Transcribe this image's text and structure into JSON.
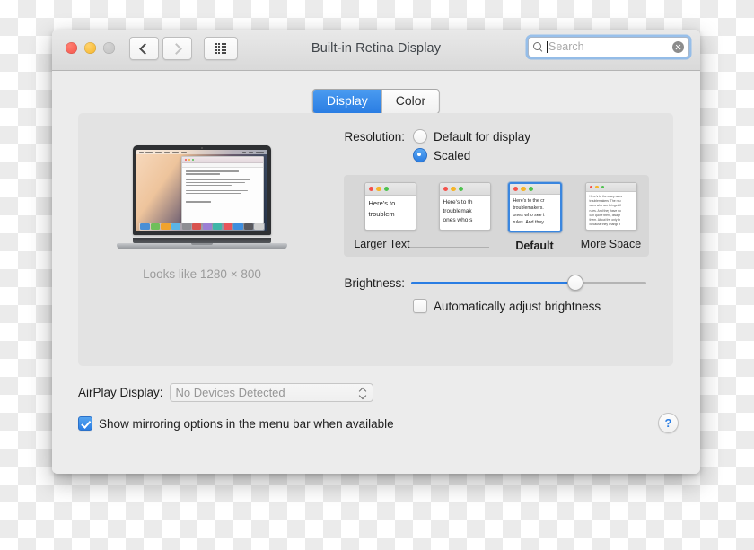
{
  "window": {
    "title": "Built-in Retina Display",
    "traffic_lights": [
      "close",
      "minimize",
      "zoom"
    ],
    "nav": {
      "back_icon": "chevron-left-icon",
      "forward_icon": "chevron-right-icon",
      "grid_icon": "show-all-grid-icon"
    },
    "search": {
      "placeholder": "Search",
      "value": "",
      "clear_icon": "clear-icon",
      "icon": "search-icon"
    }
  },
  "tabs": [
    {
      "label": "Display",
      "selected": true
    },
    {
      "label": "Color",
      "selected": false
    }
  ],
  "preview": {
    "caption": "Looks like 1280 × 800",
    "device": "macbook-retina",
    "doc_lines": [
      72,
      46,
      0,
      88,
      80,
      62,
      0,
      84,
      76,
      70,
      0,
      34,
      0,
      90
    ]
  },
  "resolution": {
    "label": "Resolution:",
    "options": [
      {
        "label": "Default for display",
        "selected": false
      },
      {
        "label": "Scaled",
        "selected": true
      }
    ]
  },
  "scaled": {
    "selected_index": 2,
    "thumbnails": [
      {
        "label": "Larger Text",
        "size": "sz-lg",
        "selected": false,
        "lines": [
          "Here's to",
          "troublem"
        ]
      },
      {
        "label": "",
        "size": "sz-md",
        "selected": false,
        "lines": [
          "Here's to th",
          "troublemak",
          "ones who s"
        ]
      },
      {
        "label": "Default",
        "size": "sz-sm",
        "selected": true,
        "lines": [
          "Here's to the cr",
          "troublemakers.",
          "ones who see t",
          "rules. And they"
        ]
      },
      {
        "label": "More Space",
        "size": "sz-xs",
        "selected": false,
        "lines": [
          "Here's to the crazy ones",
          "troublemakers. The rou",
          "ones who see things dif",
          "rules. And they have no",
          "can quote them, disagr",
          "them. About the only th",
          "Because they change t"
        ]
      }
    ]
  },
  "brightness": {
    "label": "Brightness:",
    "value_percent": 70,
    "auto_adjust": {
      "label": "Automatically adjust brightness",
      "checked": false
    }
  },
  "airplay": {
    "label": "AirPlay Display:",
    "value": "No Devices Detected",
    "enabled": false
  },
  "mirroring": {
    "label": "Show mirroring options in the menu bar when available",
    "checked": true
  },
  "help": {
    "glyph": "?"
  },
  "colors": {
    "accent": "#2a7de3",
    "window_bg": "#ececec",
    "panel_bg": "#e3e3e3",
    "strip_bg": "#d7d7d7"
  }
}
